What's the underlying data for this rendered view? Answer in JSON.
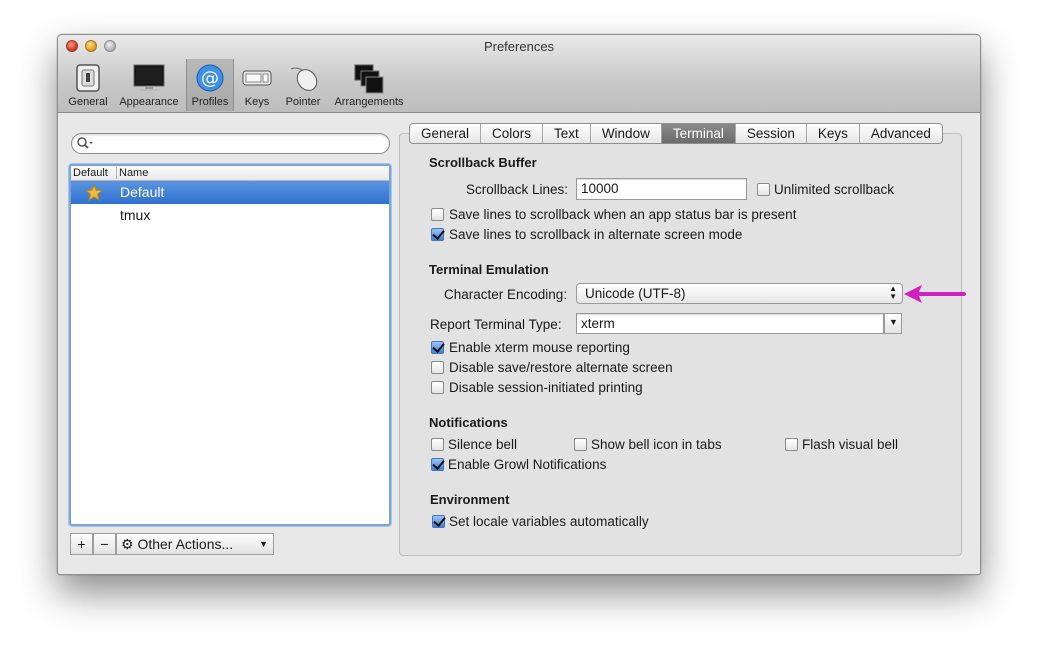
{
  "window": {
    "title": "Preferences"
  },
  "toolbar": {
    "items": [
      {
        "label": "General",
        "icon": "switch-icon"
      },
      {
        "label": "Appearance",
        "icon": "monitor-icon"
      },
      {
        "label": "Profiles",
        "icon": "at-sign-icon",
        "selected": true
      },
      {
        "label": "Keys",
        "icon": "keyboard-icon"
      },
      {
        "label": "Pointer",
        "icon": "mouse-icon"
      },
      {
        "label": "Arrangements",
        "icon": "windows-icon"
      }
    ]
  },
  "search": {
    "value": "",
    "placeholder": ""
  },
  "profile_list": {
    "columns": [
      "Default",
      "Name"
    ],
    "rows": [
      {
        "name": "Default",
        "is_default": true,
        "selected": true
      },
      {
        "name": "tmux",
        "is_default": false,
        "selected": false
      }
    ]
  },
  "list_buttons": {
    "add": "+",
    "remove": "−",
    "other_actions": "Other Actions..."
  },
  "tabs": [
    "General",
    "Colors",
    "Text",
    "Window",
    "Terminal",
    "Session",
    "Keys",
    "Advanced"
  ],
  "active_tab": "Terminal",
  "scrollback": {
    "heading": "Scrollback Buffer",
    "lines_label": "Scrollback Lines:",
    "lines_value": "10000",
    "unlimited_label": "Unlimited scrollback",
    "unlimited_checked": false,
    "status_bar_label": "Save lines to scrollback when an app status bar is present",
    "status_bar_checked": false,
    "alternate_label": "Save lines to scrollback in alternate screen mode",
    "alternate_checked": true
  },
  "emulation": {
    "heading": "Terminal Emulation",
    "encoding_label": "Character Encoding:",
    "encoding_value": "Unicode (UTF-8)",
    "report_type_label": "Report Terminal Type:",
    "report_type_value": "xterm",
    "mouse_label": "Enable xterm mouse reporting",
    "mouse_checked": true,
    "save_restore_label": "Disable save/restore alternate screen",
    "save_restore_checked": false,
    "printing_label": "Disable session-initiated printing",
    "printing_checked": false
  },
  "notifications": {
    "heading": "Notifications",
    "silence_label": "Silence bell",
    "silence_checked": false,
    "bell_icon_label": "Show bell icon in tabs",
    "bell_icon_checked": false,
    "flash_label": "Flash visual bell",
    "flash_checked": false,
    "growl_label": "Enable Growl Notifications",
    "growl_checked": true
  },
  "environment": {
    "heading": "Environment",
    "locale_label": "Set locale variables automatically",
    "locale_checked": true
  },
  "colors": {
    "annotation_arrow": "#d21fc0",
    "selection": "#3a7bd5"
  }
}
